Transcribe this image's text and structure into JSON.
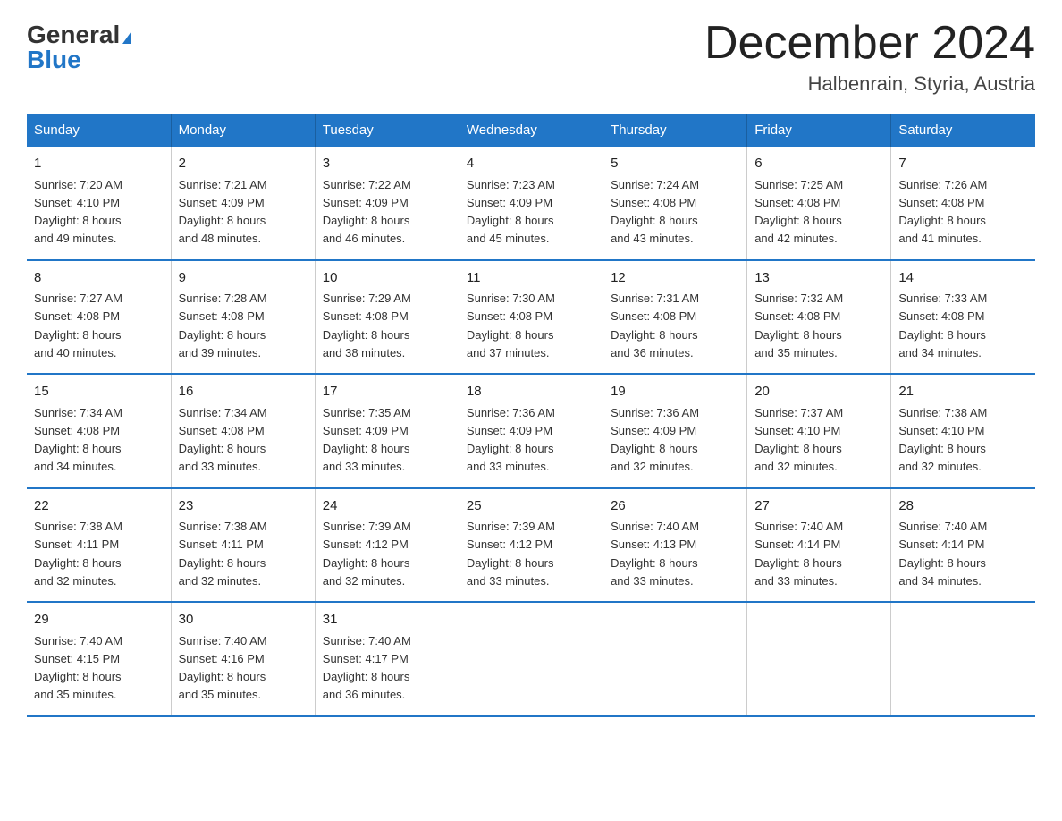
{
  "header": {
    "logo_general": "General",
    "logo_blue": "Blue",
    "month_title": "December 2024",
    "location": "Halbenrain, Styria, Austria"
  },
  "weekdays": [
    "Sunday",
    "Monday",
    "Tuesday",
    "Wednesday",
    "Thursday",
    "Friday",
    "Saturday"
  ],
  "weeks": [
    [
      {
        "day": "1",
        "sunrise": "7:20 AM",
        "sunset": "4:10 PM",
        "daylight": "8 hours and 49 minutes."
      },
      {
        "day": "2",
        "sunrise": "7:21 AM",
        "sunset": "4:09 PM",
        "daylight": "8 hours and 48 minutes."
      },
      {
        "day": "3",
        "sunrise": "7:22 AM",
        "sunset": "4:09 PM",
        "daylight": "8 hours and 46 minutes."
      },
      {
        "day": "4",
        "sunrise": "7:23 AM",
        "sunset": "4:09 PM",
        "daylight": "8 hours and 45 minutes."
      },
      {
        "day": "5",
        "sunrise": "7:24 AM",
        "sunset": "4:08 PM",
        "daylight": "8 hours and 43 minutes."
      },
      {
        "day": "6",
        "sunrise": "7:25 AM",
        "sunset": "4:08 PM",
        "daylight": "8 hours and 42 minutes."
      },
      {
        "day": "7",
        "sunrise": "7:26 AM",
        "sunset": "4:08 PM",
        "daylight": "8 hours and 41 minutes."
      }
    ],
    [
      {
        "day": "8",
        "sunrise": "7:27 AM",
        "sunset": "4:08 PM",
        "daylight": "8 hours and 40 minutes."
      },
      {
        "day": "9",
        "sunrise": "7:28 AM",
        "sunset": "4:08 PM",
        "daylight": "8 hours and 39 minutes."
      },
      {
        "day": "10",
        "sunrise": "7:29 AM",
        "sunset": "4:08 PM",
        "daylight": "8 hours and 38 minutes."
      },
      {
        "day": "11",
        "sunrise": "7:30 AM",
        "sunset": "4:08 PM",
        "daylight": "8 hours and 37 minutes."
      },
      {
        "day": "12",
        "sunrise": "7:31 AM",
        "sunset": "4:08 PM",
        "daylight": "8 hours and 36 minutes."
      },
      {
        "day": "13",
        "sunrise": "7:32 AM",
        "sunset": "4:08 PM",
        "daylight": "8 hours and 35 minutes."
      },
      {
        "day": "14",
        "sunrise": "7:33 AM",
        "sunset": "4:08 PM",
        "daylight": "8 hours and 34 minutes."
      }
    ],
    [
      {
        "day": "15",
        "sunrise": "7:34 AM",
        "sunset": "4:08 PM",
        "daylight": "8 hours and 34 minutes."
      },
      {
        "day": "16",
        "sunrise": "7:34 AM",
        "sunset": "4:08 PM",
        "daylight": "8 hours and 33 minutes."
      },
      {
        "day": "17",
        "sunrise": "7:35 AM",
        "sunset": "4:09 PM",
        "daylight": "8 hours and 33 minutes."
      },
      {
        "day": "18",
        "sunrise": "7:36 AM",
        "sunset": "4:09 PM",
        "daylight": "8 hours and 33 minutes."
      },
      {
        "day": "19",
        "sunrise": "7:36 AM",
        "sunset": "4:09 PM",
        "daylight": "8 hours and 32 minutes."
      },
      {
        "day": "20",
        "sunrise": "7:37 AM",
        "sunset": "4:10 PM",
        "daylight": "8 hours and 32 minutes."
      },
      {
        "day": "21",
        "sunrise": "7:38 AM",
        "sunset": "4:10 PM",
        "daylight": "8 hours and 32 minutes."
      }
    ],
    [
      {
        "day": "22",
        "sunrise": "7:38 AM",
        "sunset": "4:11 PM",
        "daylight": "8 hours and 32 minutes."
      },
      {
        "day": "23",
        "sunrise": "7:38 AM",
        "sunset": "4:11 PM",
        "daylight": "8 hours and 32 minutes."
      },
      {
        "day": "24",
        "sunrise": "7:39 AM",
        "sunset": "4:12 PM",
        "daylight": "8 hours and 32 minutes."
      },
      {
        "day": "25",
        "sunrise": "7:39 AM",
        "sunset": "4:12 PM",
        "daylight": "8 hours and 33 minutes."
      },
      {
        "day": "26",
        "sunrise": "7:40 AM",
        "sunset": "4:13 PM",
        "daylight": "8 hours and 33 minutes."
      },
      {
        "day": "27",
        "sunrise": "7:40 AM",
        "sunset": "4:14 PM",
        "daylight": "8 hours and 33 minutes."
      },
      {
        "day": "28",
        "sunrise": "7:40 AM",
        "sunset": "4:14 PM",
        "daylight": "8 hours and 34 minutes."
      }
    ],
    [
      {
        "day": "29",
        "sunrise": "7:40 AM",
        "sunset": "4:15 PM",
        "daylight": "8 hours and 35 minutes."
      },
      {
        "day": "30",
        "sunrise": "7:40 AM",
        "sunset": "4:16 PM",
        "daylight": "8 hours and 35 minutes."
      },
      {
        "day": "31",
        "sunrise": "7:40 AM",
        "sunset": "4:17 PM",
        "daylight": "8 hours and 36 minutes."
      },
      null,
      null,
      null,
      null
    ]
  ],
  "labels": {
    "sunrise": "Sunrise:",
    "sunset": "Sunset:",
    "daylight": "Daylight:"
  }
}
